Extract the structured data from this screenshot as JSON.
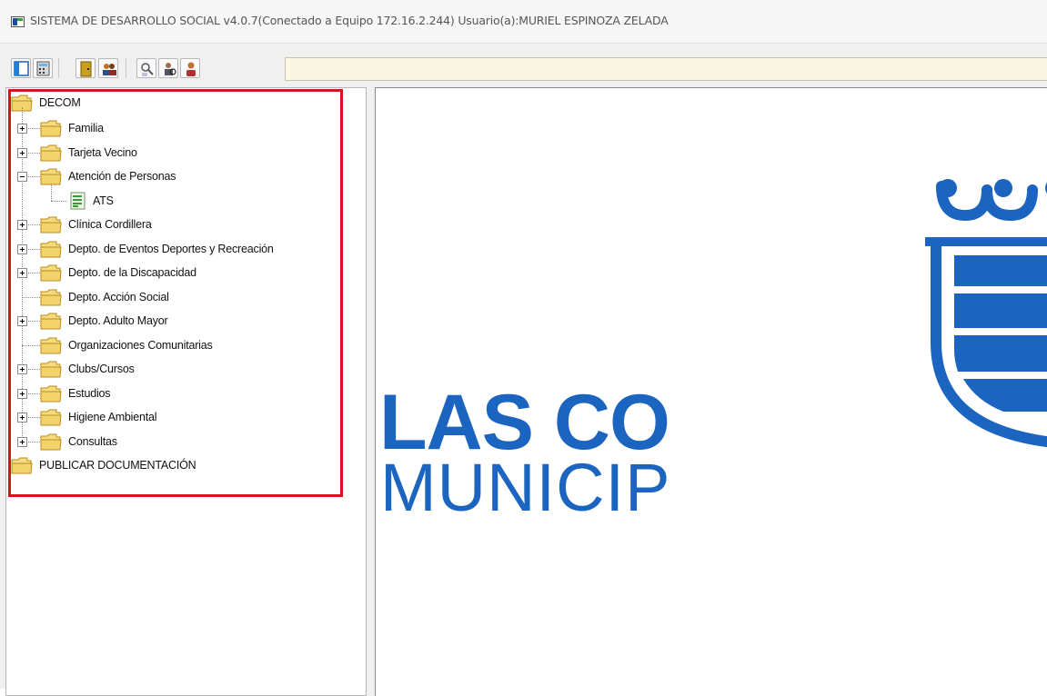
{
  "window": {
    "title": "SISTEMA DE DESARROLLO SOCIAL v4.0.7(Conectado a Equipo 172.16.2.244) Usuario(a):MURIEL ESPINOZA ZELADA"
  },
  "toolbar": {
    "buttons": [
      "window-layout-icon",
      "calculator-icon",
      "door-exit-icon",
      "users-group-icon",
      "search-person-icon",
      "person-search-icon",
      "person-icon"
    ],
    "status_field": ""
  },
  "tree": {
    "root": "DECOM",
    "items": [
      {
        "label": "Familia",
        "expanded": false
      },
      {
        "label": "Tarjeta Vecino",
        "expanded": false
      },
      {
        "label": "Atención de Personas",
        "expanded": true,
        "children": [
          {
            "label": "ATS"
          }
        ]
      },
      {
        "label": "Clínica Cordillera",
        "expanded": false
      },
      {
        "label": "Depto. de Eventos Deportes y Recreación",
        "expanded": false
      },
      {
        "label": "Depto. de la Discapacidad",
        "expanded": false
      },
      {
        "label": "Depto. Acción Social",
        "expanded": null
      },
      {
        "label": "Depto. Adulto Mayor",
        "expanded": false
      },
      {
        "label": "Organizaciones Comunitarias",
        "expanded": null
      },
      {
        "label": "Clubs/Cursos",
        "expanded": false
      },
      {
        "label": "Estudios",
        "expanded": false
      },
      {
        "label": "Higiene Ambiental",
        "expanded": false
      },
      {
        "label": "Consultas",
        "expanded": false
      }
    ],
    "root2": "PUBLICAR DOCUMENTACIÓN"
  },
  "logo": {
    "line1": "LAS CO",
    "line2": "MUNICIP",
    "color": "#1b64c0"
  },
  "colors": {
    "highlight": "#d0161e",
    "folder": "#f3d36b"
  }
}
